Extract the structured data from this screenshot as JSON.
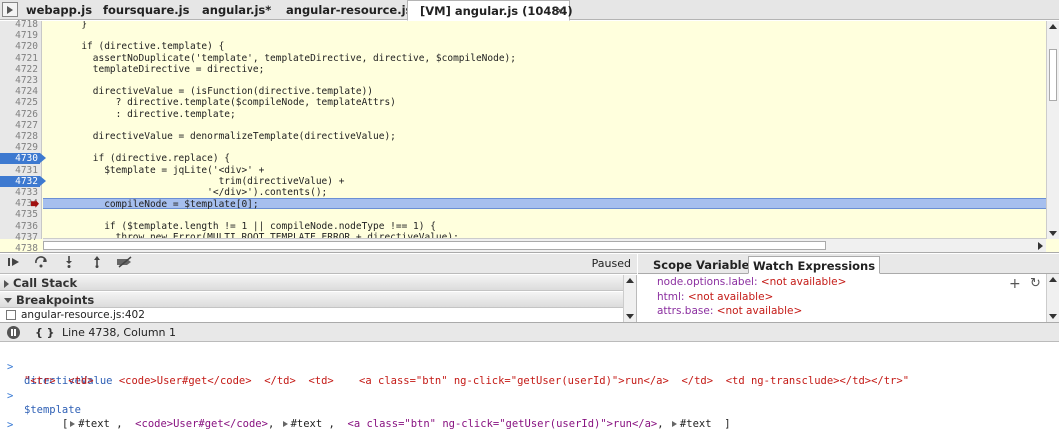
{
  "tabs": [
    {
      "label": "webapp.js",
      "active": false
    },
    {
      "label": "foursquare.js",
      "active": false
    },
    {
      "label": "angular.js*",
      "active": false
    },
    {
      "label": "angular-resource.js",
      "active": false
    },
    {
      "label": "[VM] angular.js (10484)",
      "active": true,
      "close": "✕"
    }
  ],
  "editor": {
    "lines": [
      {
        "n": "4718",
        "code": "      }"
      },
      {
        "n": "4719",
        "code": ""
      },
      {
        "n": "4720",
        "code": "      if (directive.template) {"
      },
      {
        "n": "4721",
        "code": "        assertNoDuplicate('template', templateDirective, directive, $compileNode);"
      },
      {
        "n": "4722",
        "code": "        templateDirective = directive;"
      },
      {
        "n": "4723",
        "code": ""
      },
      {
        "n": "4724",
        "code": "        directiveValue = (isFunction(directive.template))"
      },
      {
        "n": "4725",
        "code": "            ? directive.template($compileNode, templateAttrs)"
      },
      {
        "n": "4726",
        "code": "            : directive.template;"
      },
      {
        "n": "4727",
        "code": ""
      },
      {
        "n": "4728",
        "code": "        directiveValue = denormalizeTemplate(directiveValue);"
      },
      {
        "n": "4729",
        "code": ""
      },
      {
        "n": "4730",
        "code": "        if (directive.replace) {",
        "bp": true
      },
      {
        "n": "4731",
        "code": "          $template = jqLite('<div>' +"
      },
      {
        "n": "4732",
        "code": "                              trim(directiveValue) +",
        "bp": true
      },
      {
        "n": "4733",
        "code": "                            '</div>').contents();"
      },
      {
        "n": "4734",
        "code": "          compileNode = $template[0];",
        "current": true
      },
      {
        "n": "4735",
        "code": ""
      },
      {
        "n": "4736",
        "code": "          if ($template.length != 1 || compileNode.nodeType !== 1) {"
      },
      {
        "n": "4737",
        "code": "            throw new Error(MULTI_ROOT_TEMPLATE_ERROR + directiveValue);"
      },
      {
        "n": "4738",
        "code": ""
      }
    ]
  },
  "debugger": {
    "paused_label": "Paused",
    "buttons": [
      "pause-resume",
      "step-over",
      "step-into",
      "step-out",
      "deactivate-breakpoints"
    ]
  },
  "sections": {
    "call_stack": "Call Stack",
    "breakpoints": "Breakpoints",
    "breakpoint_item": "angular-resource.js:402"
  },
  "right_tabs": {
    "scope": "Scope Variables",
    "watch": "Watch Expressions"
  },
  "watches": [
    {
      "key": "node.options.label",
      "value": "<not available>"
    },
    {
      "key": "html",
      "value": "<not available>"
    },
    {
      "key": "attrs.base",
      "value": "<not available>"
    }
  ],
  "status": {
    "brace": "{ }",
    "line_col": "Line 4738, Column 1"
  },
  "console": {
    "in1": "directiveValue",
    "out1": "\"<tr>  <td>    <code>User#get</code>  </td>  <td>    <a class=\"btn\" ng-click=\"getUser(userId)\">run</a>  </td>  <td ng-transclude></td></tr>\"",
    "in2": "$template",
    "out2_open": "[",
    "out2_text1": "#text",
    "out2_code": "<code>User#get</code>",
    "out2_text2": "#text",
    "out2_link": "<a class=\"btn\" ng-click=\"getUser(userId)\">run</a>",
    "out2_text3": "#text",
    "out2_close": "]"
  }
}
